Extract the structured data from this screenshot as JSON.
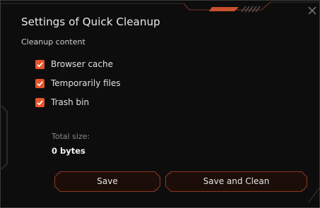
{
  "dialog": {
    "title": "Settings of Quick Cleanup",
    "section_label": "Cleanup content",
    "options": [
      {
        "label": "Browser cache",
        "checked": true
      },
      {
        "label": "Temporarily files",
        "checked": true
      },
      {
        "label": "Trash bin",
        "checked": true
      }
    ],
    "total_label": "Total size:",
    "total_value": "0 bytes",
    "buttons": {
      "save": "Save",
      "save_and_clean": "Save and Clean"
    },
    "accent_color": "#e8532b"
  }
}
